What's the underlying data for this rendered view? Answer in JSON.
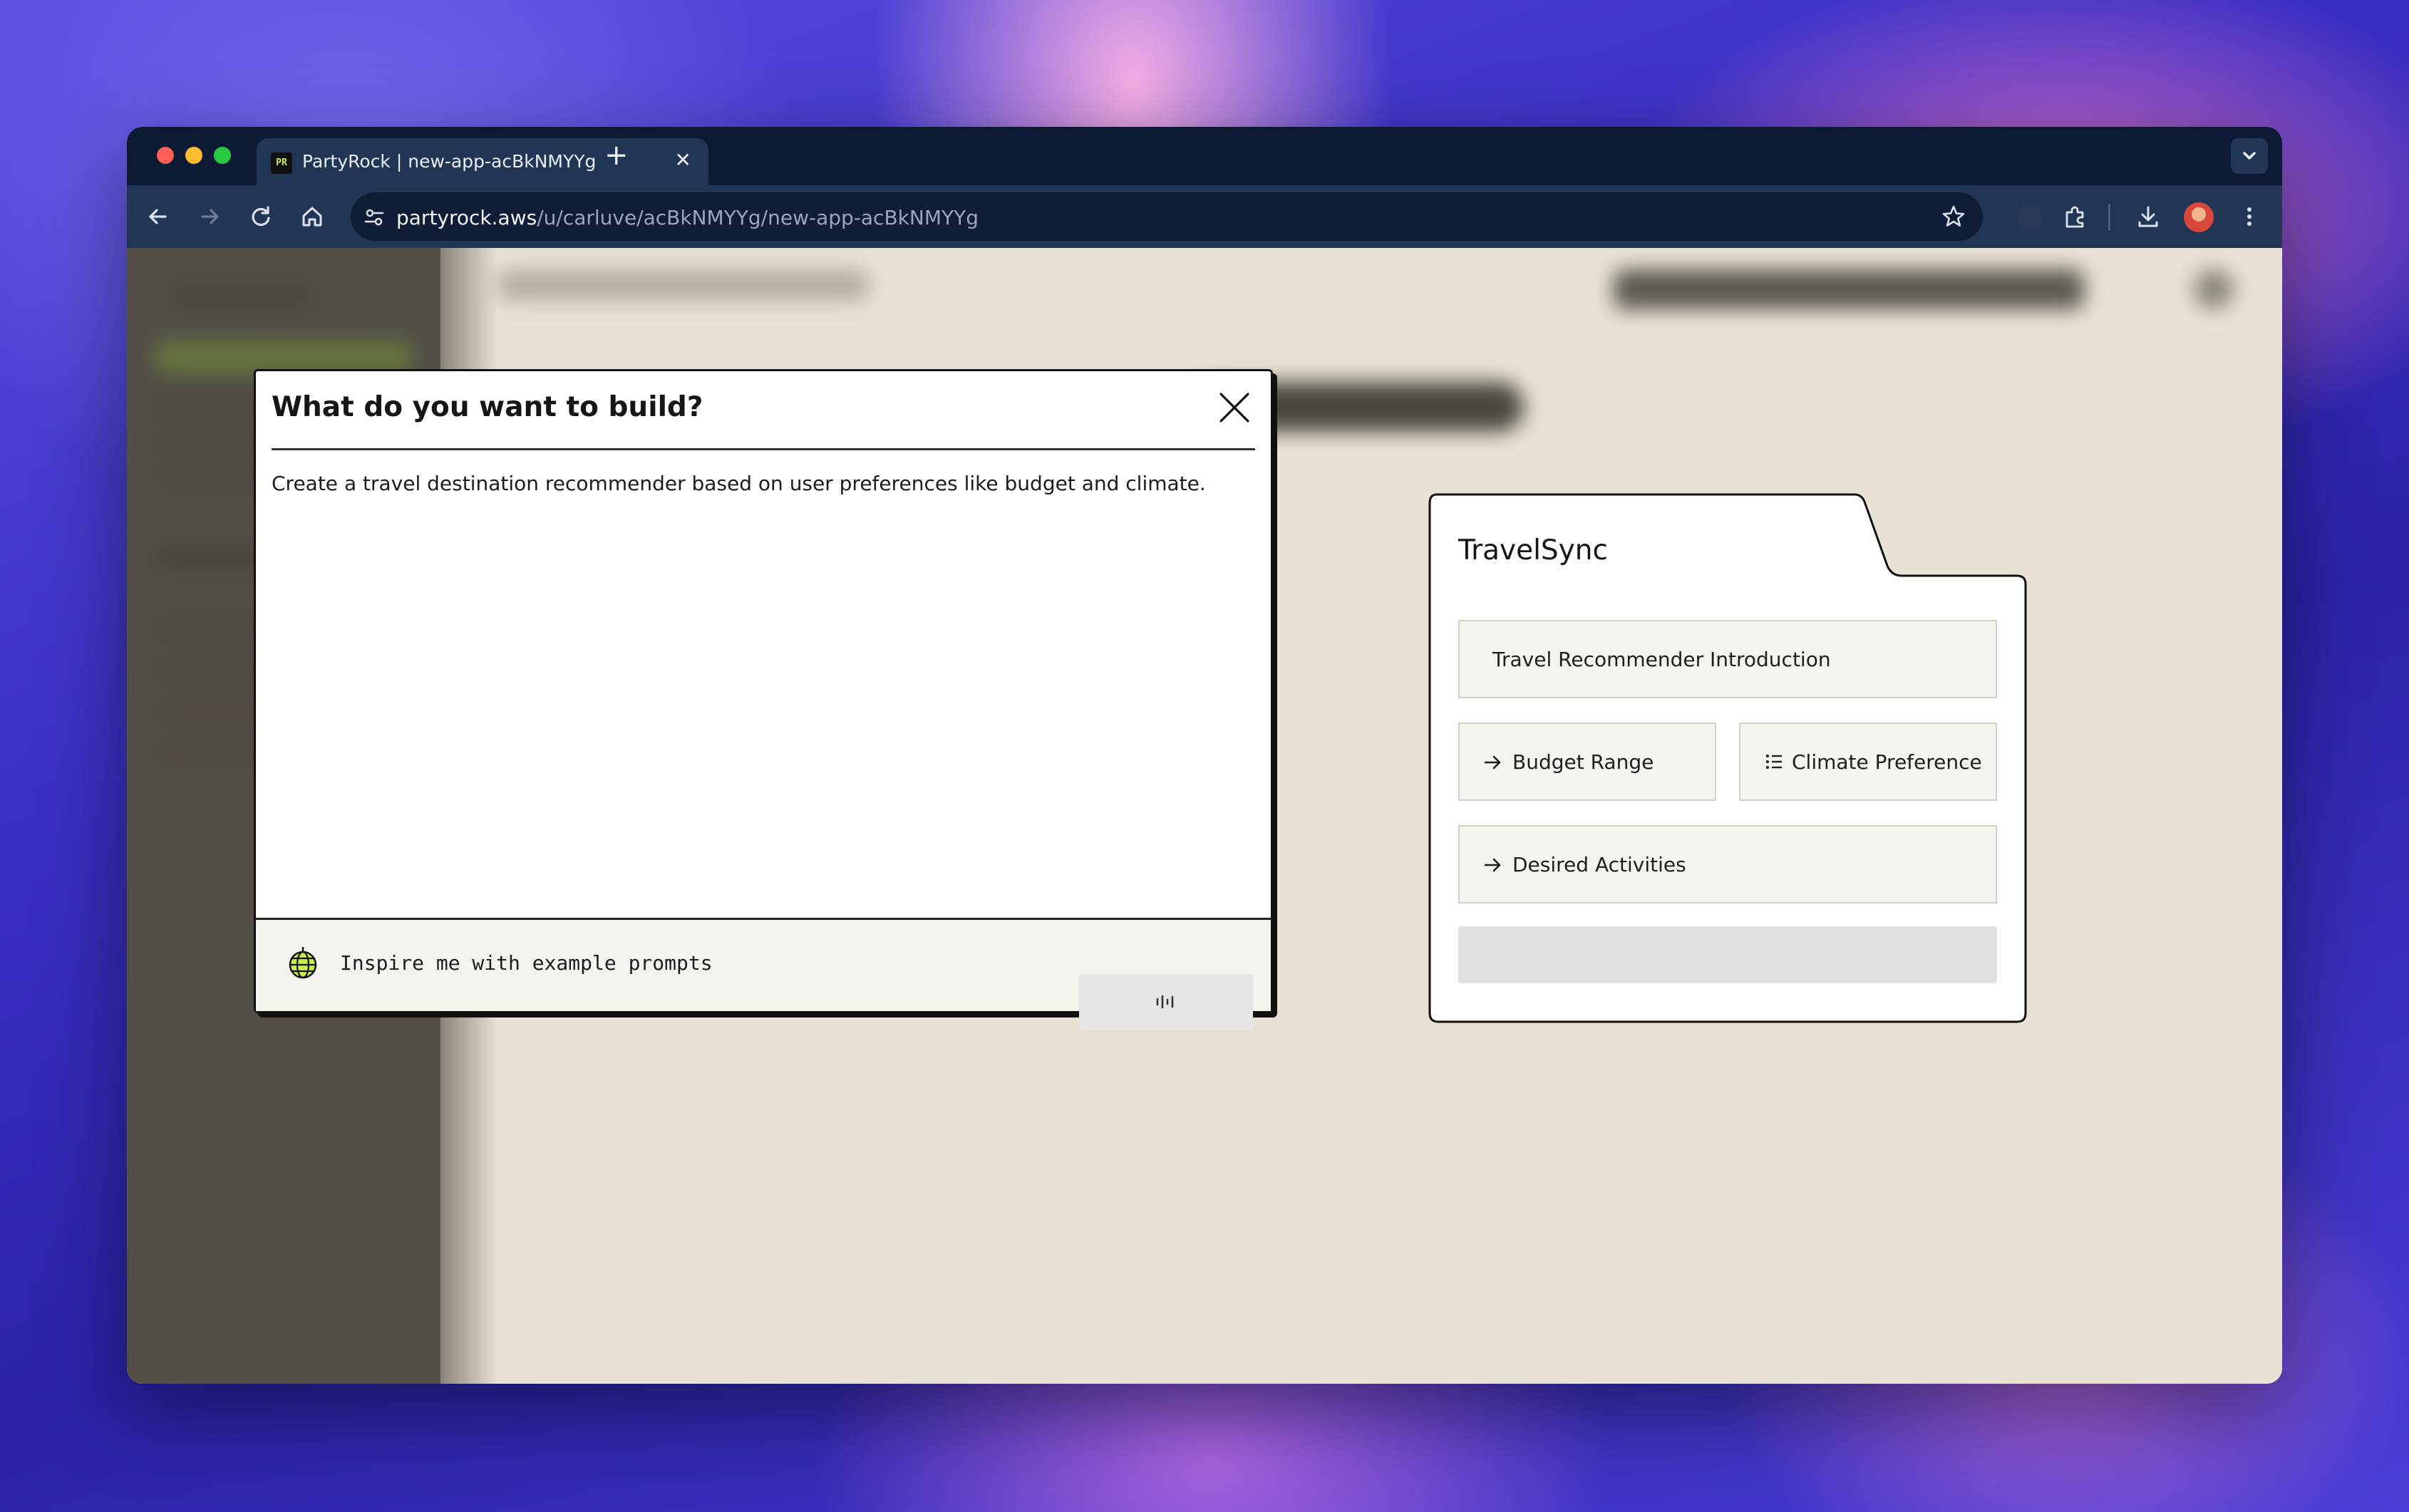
{
  "browser": {
    "tab": {
      "favicon_text": "PR",
      "title": "PartyRock | new-app-acBkNMYYg",
      "close_glyph": "✕"
    },
    "new_tab_glyph": "+",
    "url_domain": "partyrock.aws",
    "url_path": "/u/carluve/acBkNMYYg/new-app-acBkNMYYg",
    "icons": [
      "back-icon",
      "forward-icon",
      "reload-icon",
      "home-icon",
      "site-settings-icon",
      "bookmark-star-icon",
      "extensions-icon",
      "download-icon",
      "profile-avatar",
      "more-menu-icon",
      "tab-search-icon"
    ]
  },
  "modal": {
    "title": "What do you want to build?",
    "prompt_value": "Create a travel destination recommender based on user preferences like budget and climate.",
    "footer_label": "Inspire me with example prompts"
  },
  "preview": {
    "app_name": "TravelSync",
    "widgets": [
      {
        "label": "Travel Recommender Introduction",
        "icon": ""
      },
      {
        "label": "Budget Range",
        "icon": "arrow-right-icon"
      },
      {
        "label": "Climate Preference",
        "icon": "list-icon"
      },
      {
        "label": "Desired Activities",
        "icon": "arrow-right-icon"
      }
    ]
  },
  "colors": {
    "chrome_dark": "#0c1a33",
    "chrome_toolbar": "#213555",
    "app_background": "#e8e2d4",
    "widget_background": "#f5f3ee"
  }
}
